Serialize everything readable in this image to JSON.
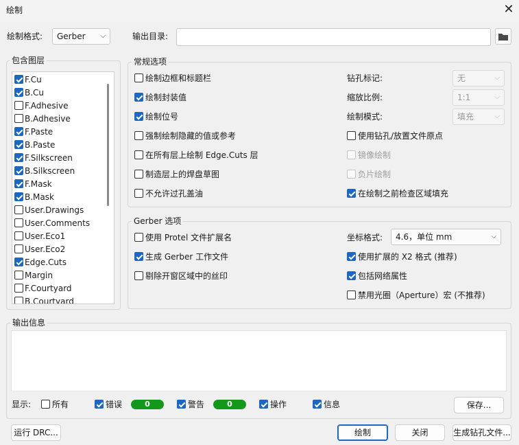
{
  "window": {
    "title": "绘制",
    "close_symbol": "✕"
  },
  "top": {
    "format_label": "绘制格式:",
    "format_value": "Gerber",
    "outdir_label": "输出目录:",
    "outdir_value": ""
  },
  "layers": {
    "title": "包含图层",
    "items": [
      {
        "label": "F.Cu",
        "checked": true
      },
      {
        "label": "B.Cu",
        "checked": true
      },
      {
        "label": "F.Adhesive",
        "checked": false
      },
      {
        "label": "B.Adhesive",
        "checked": false
      },
      {
        "label": "F.Paste",
        "checked": true
      },
      {
        "label": "B.Paste",
        "checked": true
      },
      {
        "label": "F.Silkscreen",
        "checked": true
      },
      {
        "label": "B.Silkscreen",
        "checked": true
      },
      {
        "label": "F.Mask",
        "checked": true
      },
      {
        "label": "B.Mask",
        "checked": true
      },
      {
        "label": "User.Drawings",
        "checked": false
      },
      {
        "label": "User.Comments",
        "checked": false
      },
      {
        "label": "User.Eco1",
        "checked": false
      },
      {
        "label": "User.Eco2",
        "checked": false
      },
      {
        "label": "Edge.Cuts",
        "checked": true
      },
      {
        "label": "Margin",
        "checked": false
      },
      {
        "label": "F.Courtyard",
        "checked": false
      },
      {
        "label": "B.Courtyard",
        "checked": false
      }
    ]
  },
  "general": {
    "title": "常规选项",
    "left_options": [
      {
        "label": "绘制边框和标题栏",
        "checked": false
      },
      {
        "label": "绘制封装值",
        "checked": true
      },
      {
        "label": "绘制位号",
        "checked": true
      },
      {
        "label": "强制绘制隐藏的值或参考",
        "checked": false
      },
      {
        "label": "在所有层上绘制 Edge.Cuts 层",
        "checked": false
      },
      {
        "label": "制造层上的焊盘草图",
        "checked": false
      },
      {
        "label": "不允许过孔盖油",
        "checked": false
      }
    ],
    "drill_label": "钻孔标记:",
    "drill_value": "无",
    "scale_label": "缩放比例:",
    "scale_value": "1:1",
    "mode_label": "绘制模式:",
    "mode_value": "填充",
    "right_options": [
      {
        "label": "使用钻孔/放置文件原点",
        "checked": false,
        "disabled": false
      },
      {
        "label": "镜像绘制",
        "checked": false,
        "disabled": true
      },
      {
        "label": "负片绘制",
        "checked": false,
        "disabled": true
      },
      {
        "label": "在绘制之前检查区域填充",
        "checked": true,
        "disabled": false
      }
    ]
  },
  "gerber": {
    "title": "Gerber 选项",
    "left_options": [
      {
        "label": "使用 Protel 文件扩展名",
        "checked": false
      },
      {
        "label": "生成 Gerber 工作文件",
        "checked": true
      },
      {
        "label": "剔除开窗区域中的丝印",
        "checked": false
      }
    ],
    "coord_label": "坐标格式:",
    "coord_value": "4.6，单位 mm",
    "right_options": [
      {
        "label": "使用扩展的 X2 格式 (推荐)",
        "checked": true
      },
      {
        "label": "包括网络属性",
        "checked": true
      },
      {
        "label": "禁用光圈（Aperture）宏 (不推荐)",
        "checked": false
      }
    ]
  },
  "output": {
    "title": "输出信息",
    "show_label": "显示:",
    "filters": {
      "all": {
        "label": "所有",
        "checked": false
      },
      "errors": {
        "label": "错误",
        "checked": true,
        "count": "0"
      },
      "warnings": {
        "label": "警告",
        "checked": true,
        "count": "0"
      },
      "actions": {
        "label": "操作",
        "checked": true
      },
      "info": {
        "label": "信息",
        "checked": true
      }
    },
    "save_label": "保存..."
  },
  "footer": {
    "drc_label": "运行 DRC...",
    "plot_label": "绘制",
    "close_label": "关闭",
    "drill_label": "生成钻孔文件..."
  },
  "icons": {
    "folder": "folder-icon",
    "dropdown": "chevron-down-icon"
  },
  "colors": {
    "accent": "#1b67c1",
    "badge": "#14981c"
  }
}
